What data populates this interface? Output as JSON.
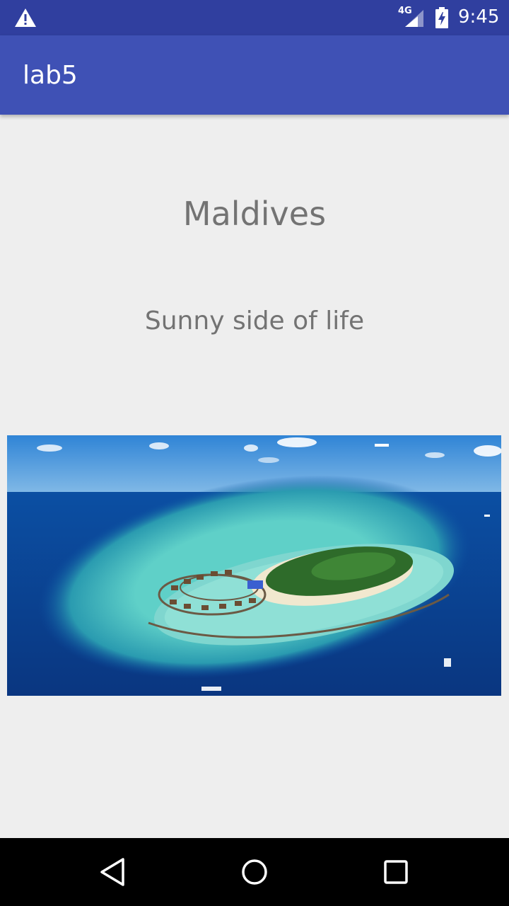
{
  "status_bar": {
    "network": "4G",
    "time": "9:45",
    "icons": [
      "warning-icon",
      "signal-icon",
      "battery-charging-icon"
    ]
  },
  "app_bar": {
    "title": "lab5"
  },
  "content": {
    "title": "Maldives",
    "subtitle": "Sunny side of life",
    "image": {
      "subject": "aerial island photo",
      "colors": {
        "sky": "#3a8ed6",
        "ocean": "#0a3f8f",
        "lagoon": "#4fc3c8",
        "island": "#2e6b2a",
        "sand": "#f1e8cf"
      }
    }
  },
  "nav_bar": {
    "icons": [
      "back-icon",
      "home-icon",
      "recents-icon"
    ]
  },
  "colors": {
    "status_bar": "#303f9f",
    "app_bar": "#3f51b5",
    "background": "#eeeeee",
    "text": "#737373"
  }
}
